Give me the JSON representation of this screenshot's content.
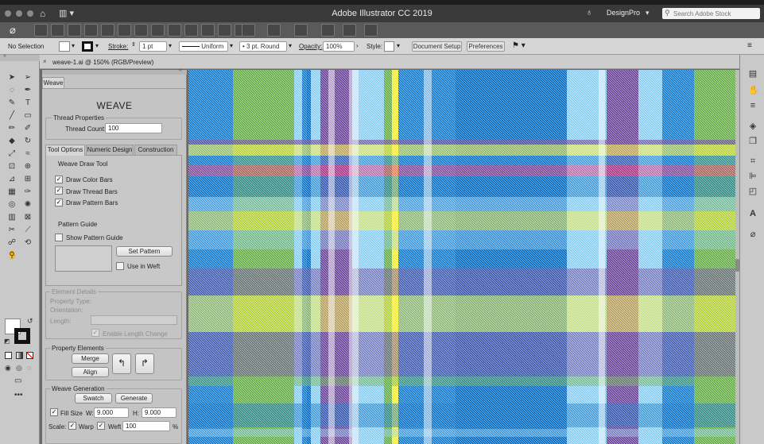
{
  "app": {
    "title": "Adobe Illustrator CC 2019",
    "workspace": "DesignPro",
    "search_placeholder": "Search Adobe Stock"
  },
  "control_bar": {
    "selection": "No Selection",
    "stroke_label": "Stroke:",
    "stroke_value": "1 pt",
    "profile": "Uniform",
    "brush": "3 pt. Round",
    "opacity_label": "Opacity:",
    "opacity_value": "100%",
    "style_label": "Style:",
    "doc_setup": "Document Setup",
    "preferences": "Preferences"
  },
  "document": {
    "tab_title": "weave-1.ai @ 150% (RGB/Preview)"
  },
  "panel": {
    "tab": "Weave",
    "heading": "WEAVE",
    "thread_props": {
      "title": "Thread Properties",
      "count_label": "Thread Count:",
      "count_value": "100"
    },
    "tabs": [
      "Tool Options",
      "Numeric Design",
      "Construction"
    ],
    "draw_tool": {
      "title": "Weave Draw Tool",
      "color_bars": "Draw Color Bars",
      "thread_bars": "Draw Thread Bars",
      "pattern_bars": "Draw Pattern Bars"
    },
    "pattern_guide": {
      "title": "Pattern Guide",
      "show": "Show Pattern Guide",
      "set": "Set Pattern",
      "weft": "Use in Weft"
    },
    "element_details": {
      "title": "Element Details",
      "type": "Property Type:",
      "orientation": "Orientation:",
      "length": "Length:",
      "enable": "Enable Length Change"
    },
    "property_elements": {
      "title": "Property Elements",
      "merge": "Merge",
      "align": "Align"
    },
    "weave_gen": {
      "title": "Weave Generation",
      "swatch": "Swatch",
      "generate": "Generate",
      "fill_size": "Fill Size",
      "w_label": "W:",
      "w_value": "9.000",
      "h_label": "H:",
      "h_value": "9.000",
      "scale_label": "Scale:",
      "warp": "Warp",
      "weft": "Weft",
      "scale_value": "100",
      "pct": "%"
    }
  },
  "colors": {
    "blue": "#1a7fd0",
    "dark_blue": "#0a6fc4",
    "green": "#6ab04c",
    "purple": "#6f4a9c",
    "magenta": "#e0337a",
    "yellow": "#f7ef3a",
    "light_blue": "#8fd0f5",
    "orange": "#f39a3a"
  }
}
